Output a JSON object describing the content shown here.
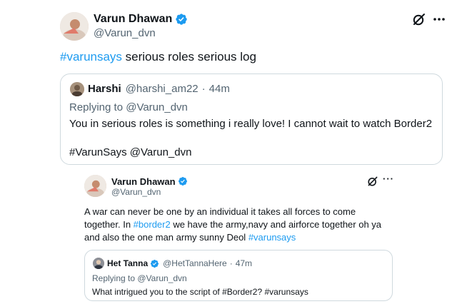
{
  "main_tweet": {
    "author_name": "Varun Dhawan",
    "author_handle": "@Varun_dvn",
    "hashtag": "#varunsays",
    "text": " serious roles serious log",
    "quote": {
      "author_name": "Harshi",
      "author_handle": "@harshi_am22",
      "sep": "·",
      "time": "44m",
      "replying_prefix": "Replying to ",
      "replying_to": "@Varun_dvn",
      "line1": "You in serious roles is something i really love! I cannot wait to watch Border2",
      "line2": "#VarunSays @Varun_dvn"
    }
  },
  "reply_tweet": {
    "author_name": "Varun Dhawan",
    "author_handle": "@Varun_dvn",
    "more": "···",
    "text_a": "A war can never be one by an individual it takes all forces to come",
    "text_b_prefix": "together. In ",
    "text_b_hashtag": "#border2",
    "text_b_suffix": " we have the army,navy and airforce together oh ya",
    "text_c_prefix": "and also the one man army sunny Deol ",
    "text_c_hashtag": "#varunsays",
    "quote": {
      "author_name": "Het Tanna",
      "author_handle": "@HetTannaHere",
      "sep": "·",
      "time": "47m",
      "replying_prefix": "Replying to ",
      "replying_to": "@Varun_dvn",
      "text": "What intrigued you to the script of #Border2? #varunsays"
    }
  },
  "colors": {
    "accent": "#1d9bf0",
    "muted": "#536471",
    "border": "#cfd9de"
  },
  "icons": [
    "grok-icon",
    "verified-badge-icon",
    "more-icon"
  ]
}
